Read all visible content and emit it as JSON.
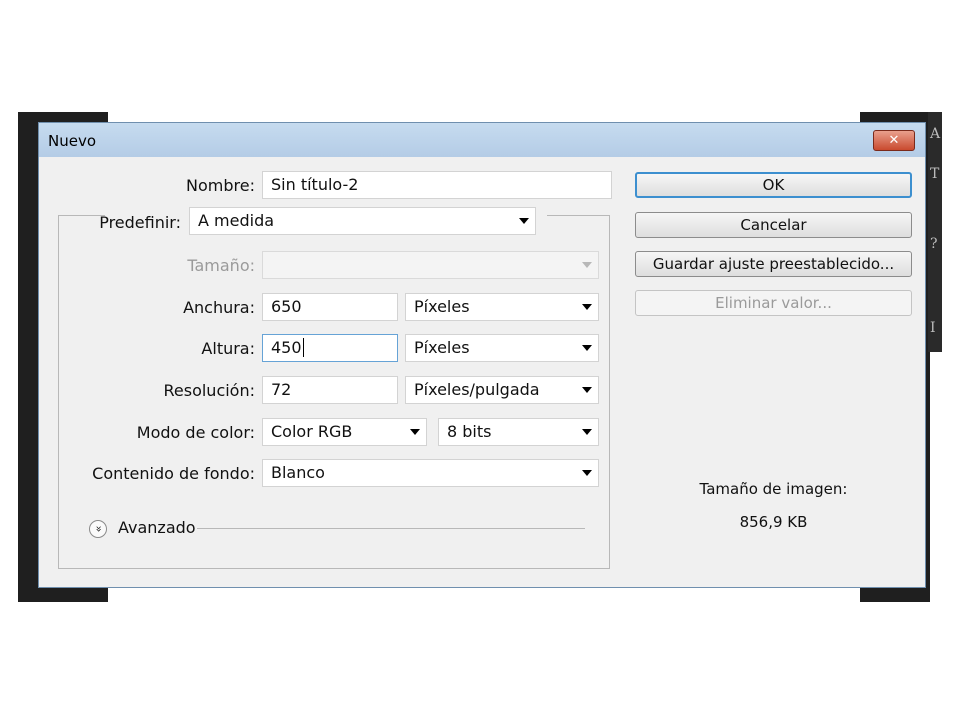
{
  "dialog": {
    "title": "Nuevo",
    "close_symbol": "✕"
  },
  "form": {
    "name": {
      "label": "Nombre:",
      "value": "Sin título-2"
    },
    "preset": {
      "label": "Predefinir:",
      "value": "A medida"
    },
    "size": {
      "label": "Tamaño:",
      "value": ""
    },
    "width": {
      "label": "Anchura:",
      "value": "650",
      "unit": "Píxeles"
    },
    "height": {
      "label": "Altura:",
      "value": "450",
      "unit": "Píxeles"
    },
    "resolution": {
      "label": "Resolución:",
      "value": "72",
      "unit": "Píxeles/pulgada"
    },
    "color_mode": {
      "label": "Modo de color:",
      "mode": "Color RGB",
      "depth": "8 bits"
    },
    "background": {
      "label": "Contenido de fondo:",
      "value": "Blanco"
    },
    "advanced": {
      "label": "Avanzado",
      "icon": "»"
    }
  },
  "buttons": {
    "ok": "OK",
    "cancel": "Cancelar",
    "save_preset": "Guardar ajuste preestablecido...",
    "delete_preset": "Eliminar valor..."
  },
  "info": {
    "image_size_label": "Tamaño de imagen:",
    "image_size_value": "856,9 KB"
  },
  "background_app": {
    "glyphs": [
      "A",
      "T",
      "?",
      "I"
    ]
  }
}
